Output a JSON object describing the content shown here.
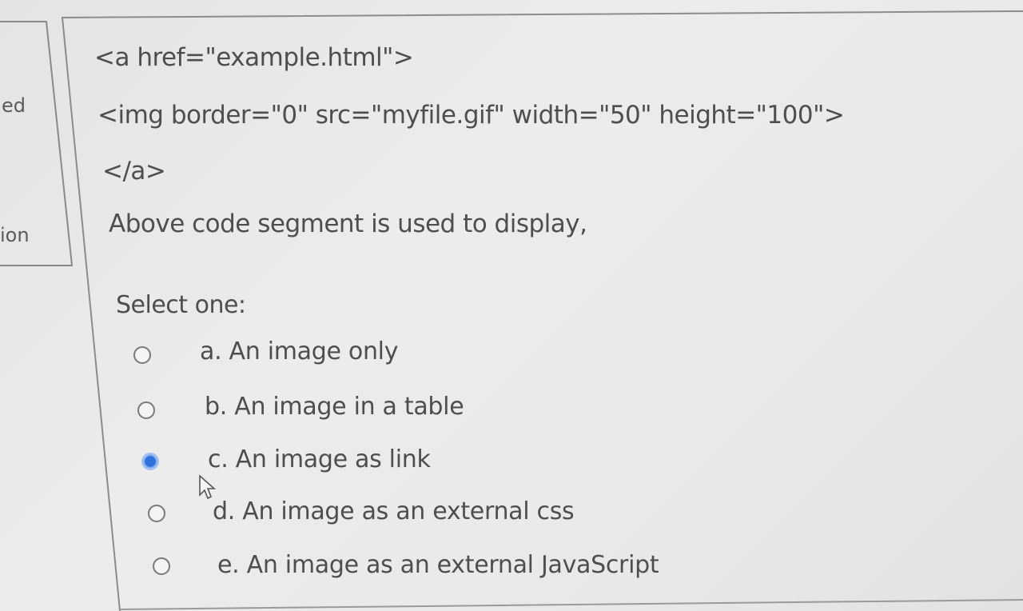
{
  "sidebar": {
    "partial_label_1": "ed",
    "partial_label_2": "ion"
  },
  "question": {
    "code_lines": [
      "<a href=\"example.html\">",
      "<img border=\"0\" src=\"myfile.gif\" width=\"50\" height=\"100\">",
      "</a>"
    ],
    "text": "Above code segment is used to display,",
    "prompt": "Select one:",
    "options": [
      {
        "label": "a. An image only",
        "selected": false
      },
      {
        "label": "b. An image in a table",
        "selected": false
      },
      {
        "label": "c. An image as link",
        "selected": true
      },
      {
        "label": "d. An image as an external css",
        "selected": false
      },
      {
        "label": "e. An image as an external JavaScript",
        "selected": false
      }
    ]
  },
  "colors": {
    "accent": "#2f72dc",
    "text": "#4e4e4e"
  }
}
